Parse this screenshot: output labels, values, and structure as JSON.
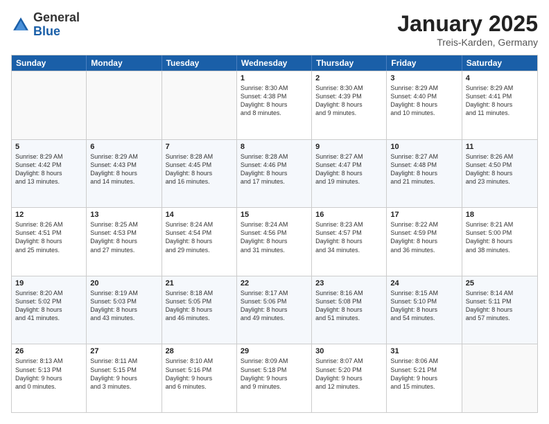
{
  "logo": {
    "general": "General",
    "blue": "Blue"
  },
  "header": {
    "month": "January 2025",
    "location": "Treis-Karden, Germany"
  },
  "weekdays": [
    "Sunday",
    "Monday",
    "Tuesday",
    "Wednesday",
    "Thursday",
    "Friday",
    "Saturday"
  ],
  "rows": [
    [
      {
        "day": "",
        "info": ""
      },
      {
        "day": "",
        "info": ""
      },
      {
        "day": "",
        "info": ""
      },
      {
        "day": "1",
        "info": "Sunrise: 8:30 AM\nSunset: 4:38 PM\nDaylight: 8 hours\nand 8 minutes."
      },
      {
        "day": "2",
        "info": "Sunrise: 8:30 AM\nSunset: 4:39 PM\nDaylight: 8 hours\nand 9 minutes."
      },
      {
        "day": "3",
        "info": "Sunrise: 8:29 AM\nSunset: 4:40 PM\nDaylight: 8 hours\nand 10 minutes."
      },
      {
        "day": "4",
        "info": "Sunrise: 8:29 AM\nSunset: 4:41 PM\nDaylight: 8 hours\nand 11 minutes."
      }
    ],
    [
      {
        "day": "5",
        "info": "Sunrise: 8:29 AM\nSunset: 4:42 PM\nDaylight: 8 hours\nand 13 minutes."
      },
      {
        "day": "6",
        "info": "Sunrise: 8:29 AM\nSunset: 4:43 PM\nDaylight: 8 hours\nand 14 minutes."
      },
      {
        "day": "7",
        "info": "Sunrise: 8:28 AM\nSunset: 4:45 PM\nDaylight: 8 hours\nand 16 minutes."
      },
      {
        "day": "8",
        "info": "Sunrise: 8:28 AM\nSunset: 4:46 PM\nDaylight: 8 hours\nand 17 minutes."
      },
      {
        "day": "9",
        "info": "Sunrise: 8:27 AM\nSunset: 4:47 PM\nDaylight: 8 hours\nand 19 minutes."
      },
      {
        "day": "10",
        "info": "Sunrise: 8:27 AM\nSunset: 4:48 PM\nDaylight: 8 hours\nand 21 minutes."
      },
      {
        "day": "11",
        "info": "Sunrise: 8:26 AM\nSunset: 4:50 PM\nDaylight: 8 hours\nand 23 minutes."
      }
    ],
    [
      {
        "day": "12",
        "info": "Sunrise: 8:26 AM\nSunset: 4:51 PM\nDaylight: 8 hours\nand 25 minutes."
      },
      {
        "day": "13",
        "info": "Sunrise: 8:25 AM\nSunset: 4:53 PM\nDaylight: 8 hours\nand 27 minutes."
      },
      {
        "day": "14",
        "info": "Sunrise: 8:24 AM\nSunset: 4:54 PM\nDaylight: 8 hours\nand 29 minutes."
      },
      {
        "day": "15",
        "info": "Sunrise: 8:24 AM\nSunset: 4:56 PM\nDaylight: 8 hours\nand 31 minutes."
      },
      {
        "day": "16",
        "info": "Sunrise: 8:23 AM\nSunset: 4:57 PM\nDaylight: 8 hours\nand 34 minutes."
      },
      {
        "day": "17",
        "info": "Sunrise: 8:22 AM\nSunset: 4:59 PM\nDaylight: 8 hours\nand 36 minutes."
      },
      {
        "day": "18",
        "info": "Sunrise: 8:21 AM\nSunset: 5:00 PM\nDaylight: 8 hours\nand 38 minutes."
      }
    ],
    [
      {
        "day": "19",
        "info": "Sunrise: 8:20 AM\nSunset: 5:02 PM\nDaylight: 8 hours\nand 41 minutes."
      },
      {
        "day": "20",
        "info": "Sunrise: 8:19 AM\nSunset: 5:03 PM\nDaylight: 8 hours\nand 43 minutes."
      },
      {
        "day": "21",
        "info": "Sunrise: 8:18 AM\nSunset: 5:05 PM\nDaylight: 8 hours\nand 46 minutes."
      },
      {
        "day": "22",
        "info": "Sunrise: 8:17 AM\nSunset: 5:06 PM\nDaylight: 8 hours\nand 49 minutes."
      },
      {
        "day": "23",
        "info": "Sunrise: 8:16 AM\nSunset: 5:08 PM\nDaylight: 8 hours\nand 51 minutes."
      },
      {
        "day": "24",
        "info": "Sunrise: 8:15 AM\nSunset: 5:10 PM\nDaylight: 8 hours\nand 54 minutes."
      },
      {
        "day": "25",
        "info": "Sunrise: 8:14 AM\nSunset: 5:11 PM\nDaylight: 8 hours\nand 57 minutes."
      }
    ],
    [
      {
        "day": "26",
        "info": "Sunrise: 8:13 AM\nSunset: 5:13 PM\nDaylight: 9 hours\nand 0 minutes."
      },
      {
        "day": "27",
        "info": "Sunrise: 8:11 AM\nSunset: 5:15 PM\nDaylight: 9 hours\nand 3 minutes."
      },
      {
        "day": "28",
        "info": "Sunrise: 8:10 AM\nSunset: 5:16 PM\nDaylight: 9 hours\nand 6 minutes."
      },
      {
        "day": "29",
        "info": "Sunrise: 8:09 AM\nSunset: 5:18 PM\nDaylight: 9 hours\nand 9 minutes."
      },
      {
        "day": "30",
        "info": "Sunrise: 8:07 AM\nSunset: 5:20 PM\nDaylight: 9 hours\nand 12 minutes."
      },
      {
        "day": "31",
        "info": "Sunrise: 8:06 AM\nSunset: 5:21 PM\nDaylight: 9 hours\nand 15 minutes."
      },
      {
        "day": "",
        "info": ""
      }
    ]
  ]
}
